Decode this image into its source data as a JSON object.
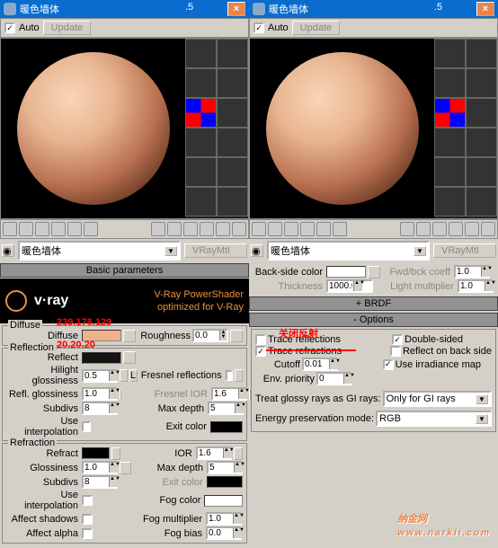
{
  "colors": {
    "diffuse": "#efb288",
    "reflect": "#141414",
    "refract": "#000000",
    "exit": "#000000",
    "fog": "#ffffff",
    "backside": "#ffffff"
  },
  "title": "暖色墙体",
  "floatnum": ".5",
  "auto": "Auto",
  "update": "Update",
  "namebar": {
    "picker": "◉",
    "material": "暖色墙体",
    "type": "VRayMtl"
  },
  "roll": {
    "basic": "Basic parameters",
    "brdf": "BRDF",
    "options": "Options"
  },
  "logo": {
    "name": "v·ray",
    "line1": "V-Ray PowerShader",
    "line2": "optimized for V-Ray"
  },
  "anno": {
    "diffuse": "239.178.129",
    "reflect": "20.20.20",
    "closeRefl": "关闭反射"
  },
  "diffuse": {
    "group": "Diffuse",
    "label": "Diffuse",
    "rough": "Roughness",
    "roughv": "0.0"
  },
  "refl": {
    "group": "Reflection",
    "reflect": "Reflect",
    "hilight": "Hilight glossiness",
    "hilightv": "0.5",
    "reflg": "Refl. glossiness",
    "reflgv": "1.0",
    "subdivs": "Subdivs",
    "subdivsv": "8",
    "useint": "Use interpolation",
    "L": "L",
    "fresnel": "Fresnel reflections",
    "ior": "Fresnel IOR",
    "iorv": "1.6",
    "maxd": "Max depth",
    "maxdv": "5",
    "exit": "Exit color"
  },
  "refr": {
    "group": "Refraction",
    "refract": "Refract",
    "gloss": "Glossiness",
    "glossv": "1.0",
    "subdivs": "Subdivs",
    "subdivsv": "8",
    "useint": "Use interpolation",
    "shadow": "Affect shadows",
    "alpha": "Affect alpha",
    "ior": "IOR",
    "iorv": "1.6",
    "maxd": "Max depth",
    "maxdv": "5",
    "exit": "Exit color",
    "fogc": "Fog color",
    "fogm": "Fog multiplier",
    "fogmv": "1.0",
    "fogb": "Fog bias",
    "fogbv": "0.0"
  },
  "opts": {
    "backcolor": "Back-side color",
    "fwdbck": "Fwd/bck coeff",
    "fwdbckv": "1.0",
    "thick": "Thickness",
    "thickv": "1000.0",
    "lightmul": "Light multiplier",
    "lightmulv": "1.0",
    "tracerefl": "Trace reflections",
    "tracerefr": "Trace refractions",
    "cutoff": "Cutoff",
    "cutoffv": "0.01",
    "envp": "Env. priority",
    "envpv": "0",
    "double": "Double-sided",
    "reflback": "Reflect on back side",
    "irr": "Use irradiance map",
    "glossy": "Treat glossy rays as GI rays:",
    "glossyv": "Only for GI rays",
    "energy": "Energy preservation mode:",
    "energyv": "RGB"
  },
  "wm": {
    "main": "纳金网",
    "sub": "www.narkii.com"
  }
}
